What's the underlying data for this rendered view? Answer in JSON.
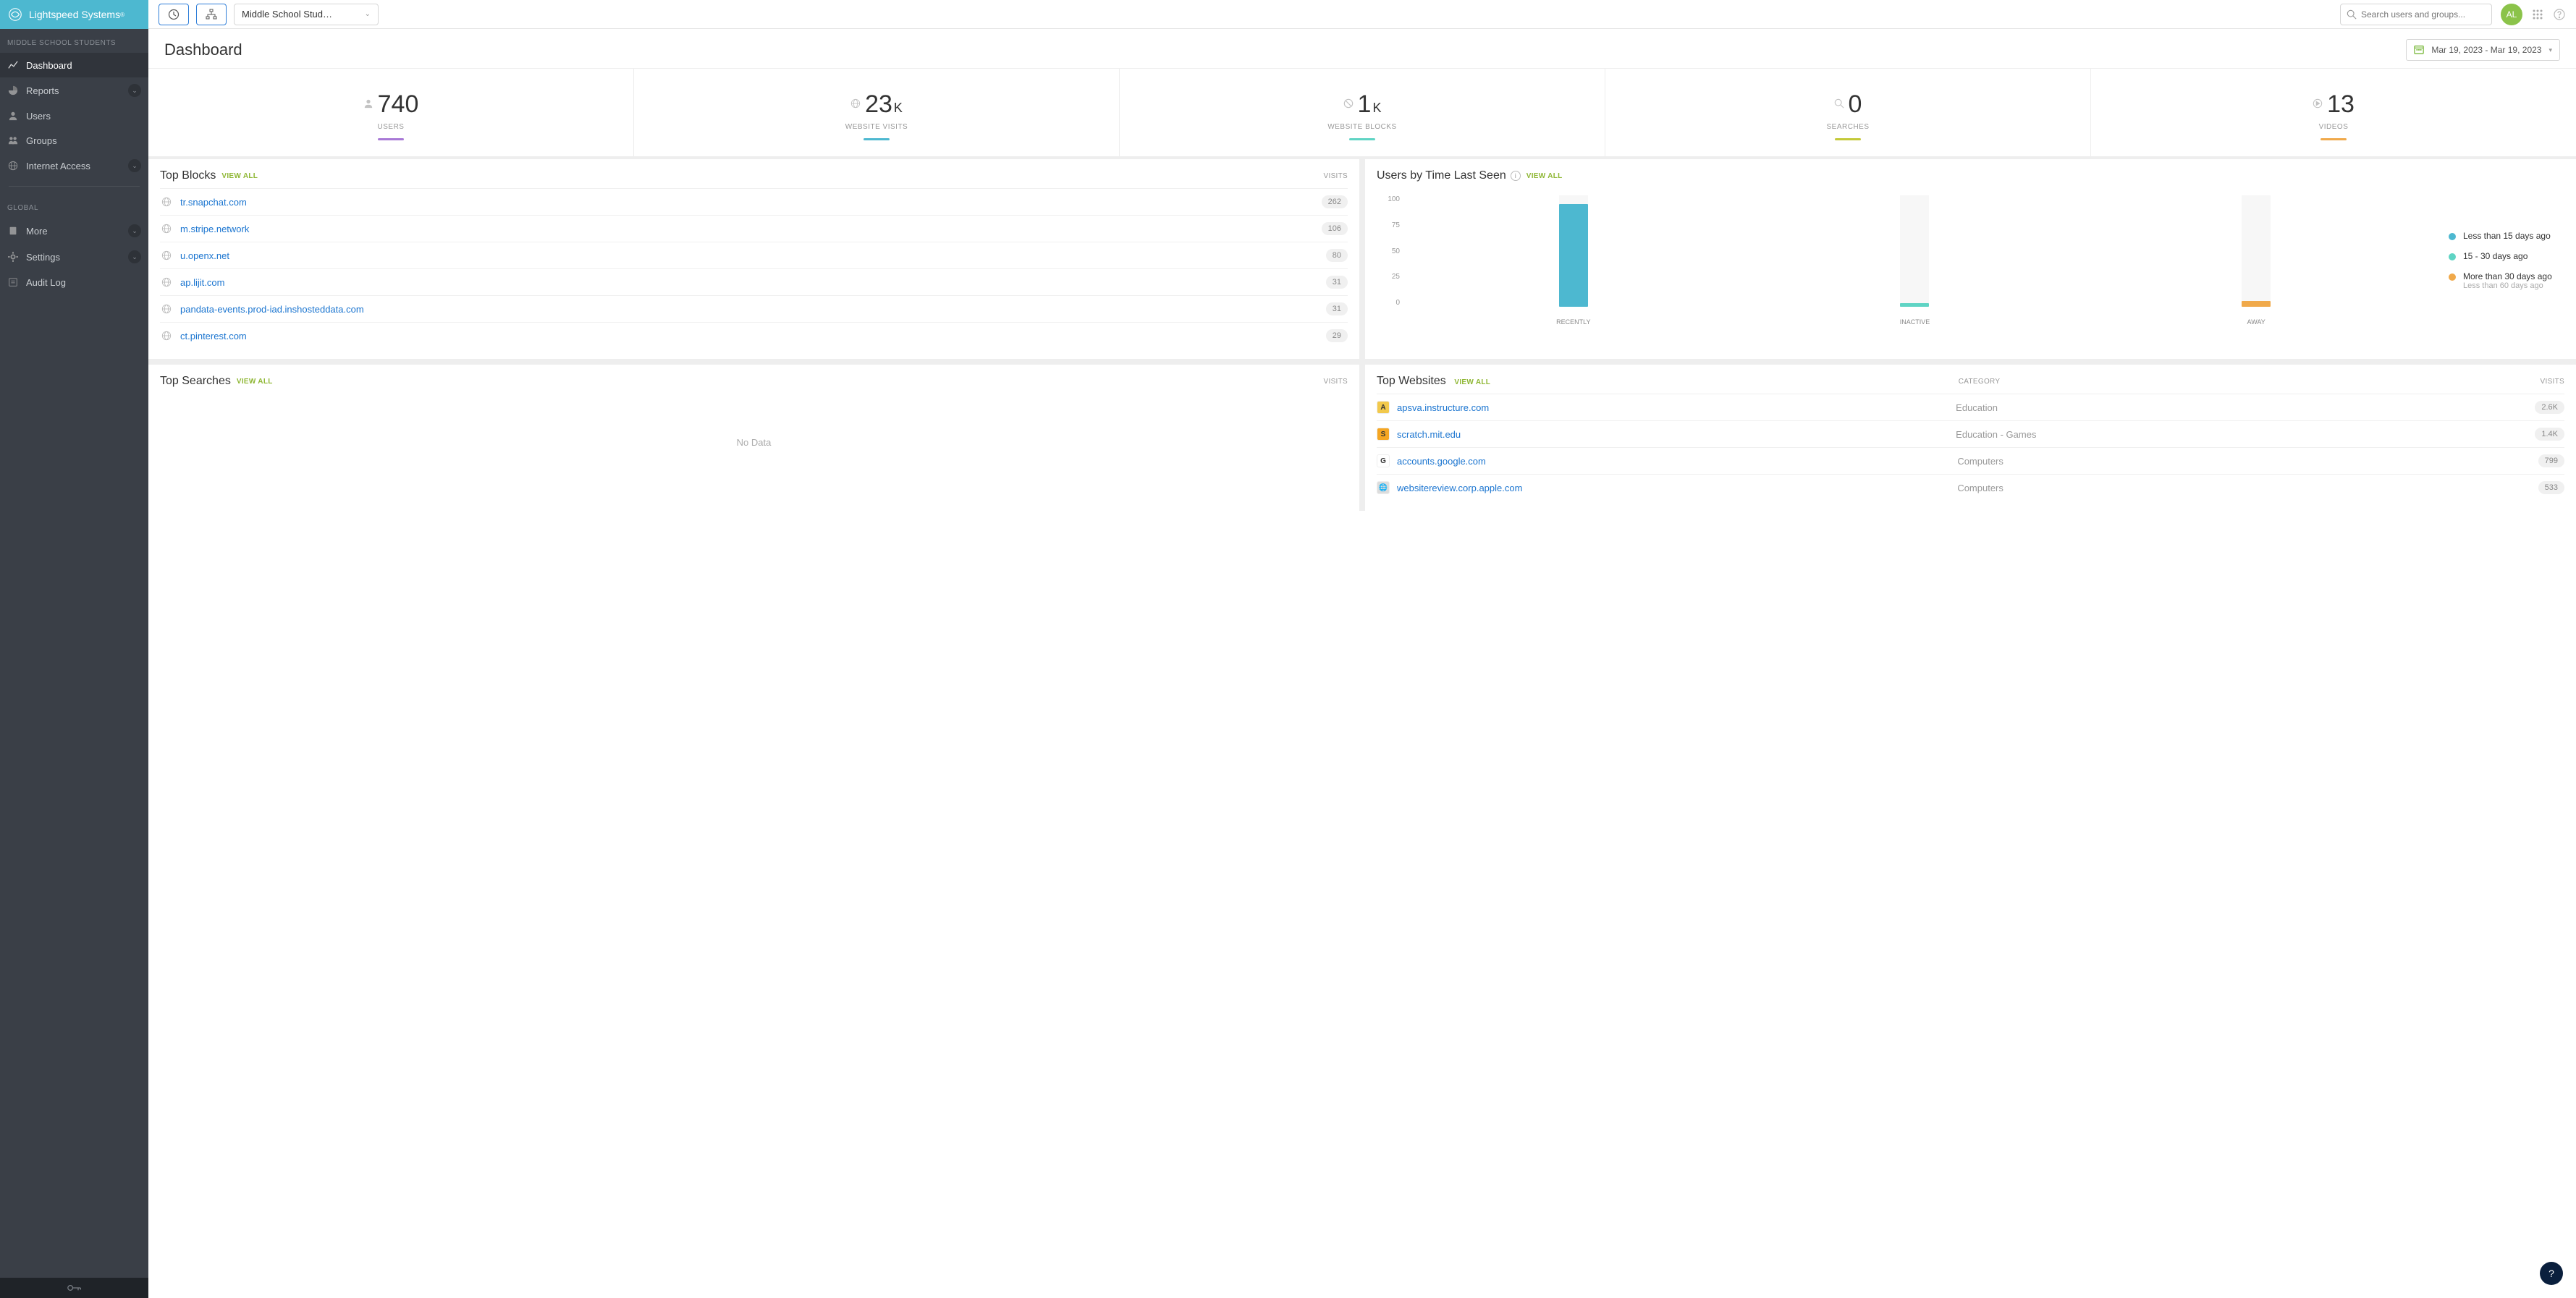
{
  "brand": "Lightspeed Systems",
  "sidebar": {
    "section1_label": "MIDDLE SCHOOL STUDENTS",
    "section2_label": "GLOBAL",
    "items1": [
      {
        "label": "Dashboard",
        "name": "dashboard"
      },
      {
        "label": "Reports",
        "name": "reports",
        "expandable": true
      },
      {
        "label": "Users",
        "name": "users"
      },
      {
        "label": "Groups",
        "name": "groups"
      },
      {
        "label": "Internet Access",
        "name": "internet-access",
        "expandable": true
      }
    ],
    "items2": [
      {
        "label": "More",
        "name": "more",
        "expandable": true
      },
      {
        "label": "Settings",
        "name": "settings",
        "expandable": true
      },
      {
        "label": "Audit Log",
        "name": "audit-log"
      }
    ]
  },
  "topbar": {
    "group_selector": "Middle School Stud…",
    "search_placeholder": "Search users and groups...",
    "avatar_initials": "AL"
  },
  "dashboard": {
    "title": "Dashboard",
    "date_range": "Mar 19, 2023 - Mar 19, 2023"
  },
  "stats": [
    {
      "value": "740",
      "suffix": "",
      "label": "USERS",
      "color": "#a879d6",
      "icon": "user"
    },
    {
      "value": "23",
      "suffix": "K",
      "label": "WEBSITE VISITS",
      "color": "#4db8d0",
      "icon": "globe"
    },
    {
      "value": "1",
      "suffix": "K",
      "label": "WEBSITE BLOCKS",
      "color": "#5fd4c4",
      "icon": "block"
    },
    {
      "value": "0",
      "suffix": "",
      "label": "SEARCHES",
      "color": "#c4c938",
      "icon": "search"
    },
    {
      "value": "13",
      "suffix": "",
      "label": "VIDEOS",
      "color": "#f0a94a",
      "icon": "video"
    }
  ],
  "top_blocks": {
    "title": "Top Blocks",
    "view_all": "VIEW ALL",
    "col_label": "VISITS",
    "rows": [
      {
        "domain": "tr.snapchat.com",
        "count": "262"
      },
      {
        "domain": "m.stripe.network",
        "count": "106"
      },
      {
        "domain": "u.openx.net",
        "count": "80"
      },
      {
        "domain": "ap.lijit.com",
        "count": "31"
      },
      {
        "domain": "pandata-events.prod-iad.inshosteddata.com",
        "count": "31"
      },
      {
        "domain": "ct.pinterest.com",
        "count": "29"
      }
    ]
  },
  "users_last_seen": {
    "title": "Users by Time Last Seen",
    "view_all": "VIEW ALL",
    "legend": [
      {
        "label": "Less than 15 days ago",
        "color": "#4db8d0",
        "sub": ""
      },
      {
        "label": "15 - 30 days ago",
        "color": "#5fd4c4",
        "sub": ""
      },
      {
        "label": "More than 30 days ago",
        "color": "#f0a94a",
        "sub": "Less than 60 days ago"
      }
    ]
  },
  "chart_data": {
    "type": "bar",
    "categories": [
      "RECENTLY",
      "INACTIVE",
      "AWAY"
    ],
    "values": [
      92,
      3,
      5
    ],
    "colors": [
      "#4db8d0",
      "#5fd4c4",
      "#f0a94a"
    ],
    "ylim": [
      0,
      100
    ],
    "yticks": [
      0,
      25,
      50,
      75,
      100
    ]
  },
  "top_searches": {
    "title": "Top Searches",
    "view_all": "VIEW ALL",
    "col_label": "VISITS",
    "no_data": "No Data"
  },
  "top_websites": {
    "title": "Top Websites",
    "view_all": "VIEW ALL",
    "col_category": "CATEGORY",
    "col_visits": "VISITS",
    "rows": [
      {
        "domain": "apsva.instructure.com",
        "category": "Education",
        "count": "2.6K",
        "favicon_bg": "#f2c94c",
        "favicon_txt": "A"
      },
      {
        "domain": "scratch.mit.edu",
        "category": "Education - Games",
        "count": "1.4K",
        "favicon_bg": "#f5a623",
        "favicon_txt": "S"
      },
      {
        "domain": "accounts.google.com",
        "category": "Computers",
        "count": "799",
        "favicon_bg": "#fff",
        "favicon_txt": "G"
      },
      {
        "domain": "websitereview.corp.apple.com",
        "category": "Computers",
        "count": "533",
        "favicon_bg": "#ddd",
        "favicon_txt": "🌐"
      }
    ]
  }
}
